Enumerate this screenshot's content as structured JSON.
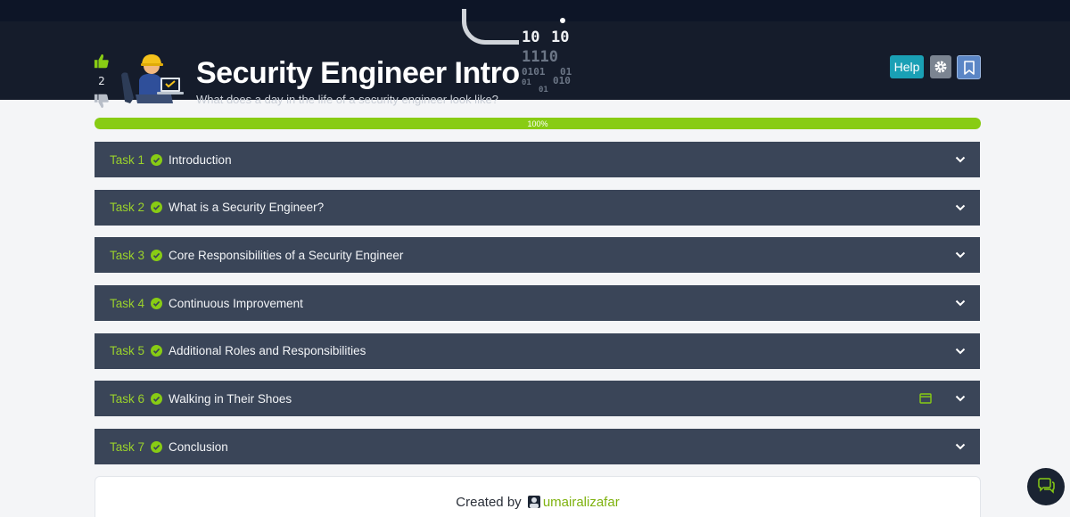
{
  "header": {
    "title": "Security Engineer Intro",
    "subtitle": "What does a day in the life of a security engineer look like?",
    "vote_count": "2",
    "help_label": "Help",
    "decor_binary": [
      "10",
      "10",
      "1110",
      "0101",
      "01",
      "01",
      "010",
      "01"
    ]
  },
  "progress": {
    "value": 100,
    "label": "100%"
  },
  "tasks": [
    {
      "number": "Task 1",
      "name": "Introduction"
    },
    {
      "number": "Task 2",
      "name": "What is a Security Engineer?"
    },
    {
      "number": "Task 3",
      "name": "Core Responsibilities of a Security Engineer"
    },
    {
      "number": "Task 4",
      "name": "Continuous Improvement"
    },
    {
      "number": "Task 5",
      "name": "Additional Roles and Responsibilities"
    },
    {
      "number": "Task 6",
      "name": "Walking in Their Shoes"
    },
    {
      "number": "Task 7",
      "name": "Conclusion"
    }
  ],
  "footer": {
    "created_by_label": "Created by",
    "author": "umairalizafar"
  },
  "colors": {
    "accent_green": "#88cc14",
    "task_bg": "#3a4558",
    "header_bg": "#151c2b",
    "help_button": "#1aa0b5",
    "bookmark_button": "#5b86c6"
  },
  "icons": {
    "upvote": "thumbs-up-icon",
    "downvote": "thumbs-down-icon",
    "settings": "gear-icon",
    "bookmark": "bookmark-icon",
    "completed": "check-circle-icon",
    "expand": "chevron-down-icon",
    "split_view": "browser-window-icon",
    "chat": "chat-icon"
  }
}
